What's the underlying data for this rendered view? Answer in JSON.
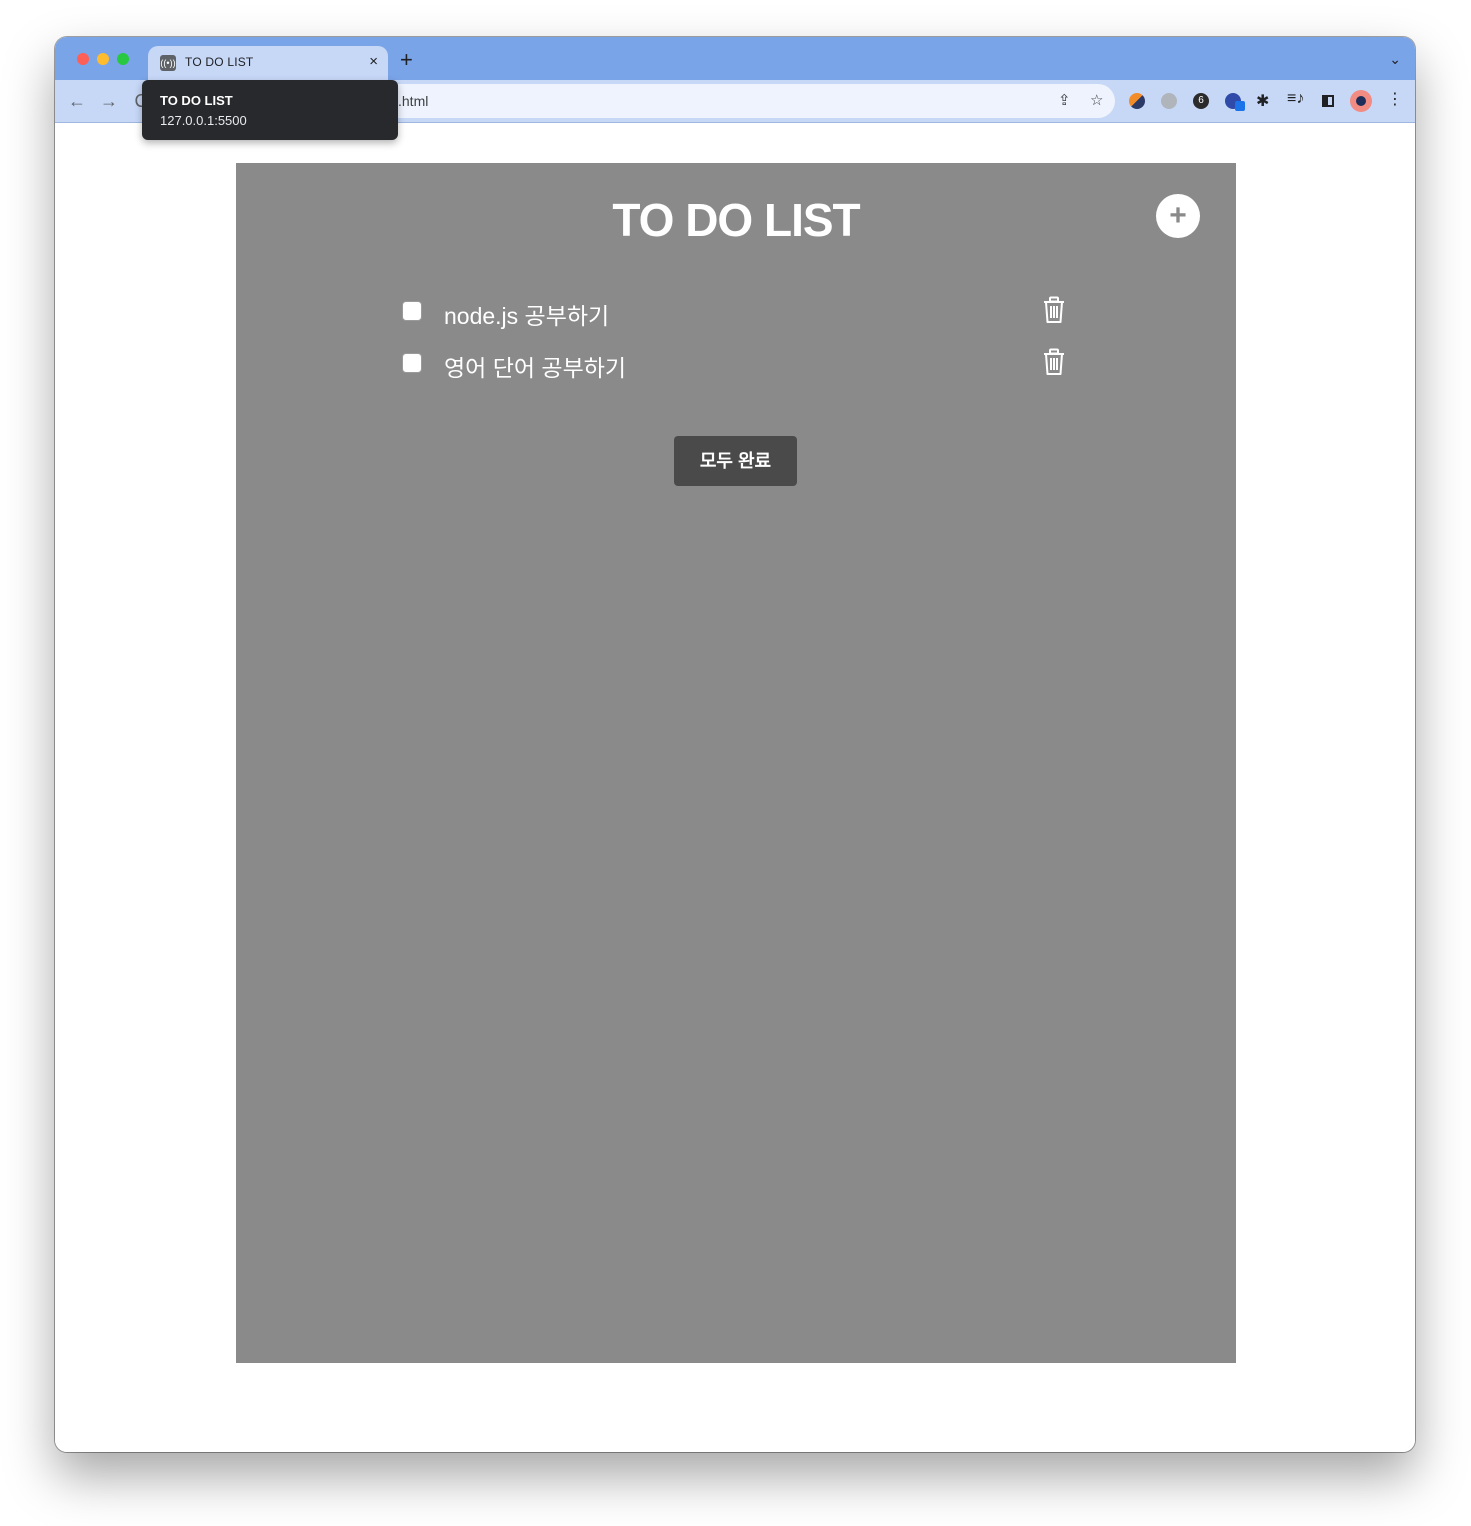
{
  "browser": {
    "tab": {
      "title": "TO DO LIST",
      "close_glyph": "×",
      "favicon": "((•))"
    },
    "new_tab_glyph": "+",
    "tab_dropdown_glyph": "⌄",
    "nav": {
      "back_glyph": "←",
      "forward_glyph": "→",
      "reload_glyph": "C"
    },
    "url_visible": ".html",
    "tooltip": {
      "title": "TO DO LIST",
      "url": "127.0.0.1:5500"
    },
    "icons": {
      "share": "⇪",
      "star": "☆",
      "extension_3": "6",
      "puzzle": "✱",
      "media": "≡♪",
      "menu": "⋮"
    },
    "colors": {
      "tabstrip": "#7aa4e8",
      "toolbar": "#c7d8f7"
    }
  },
  "app": {
    "title": "TO DO LIST",
    "add_glyph": "+",
    "todos": [
      {
        "text": "node.js 공부하기",
        "checked": false
      },
      {
        "text": "영어 단어 공부하기",
        "checked": false
      }
    ],
    "complete_all_label": "모두 완료",
    "colors": {
      "panel": "#8a8a8a",
      "button": "#4a4a4a",
      "text": "#ffffff"
    }
  }
}
